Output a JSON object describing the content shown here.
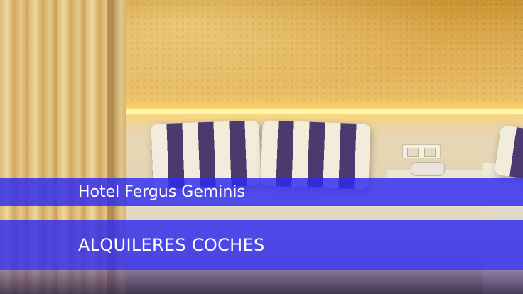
{
  "banner": {
    "hotel_name": "Hotel Fergus Geminis",
    "subtitle": "ALQUILERES COCHES",
    "color": "#2d2af0"
  }
}
